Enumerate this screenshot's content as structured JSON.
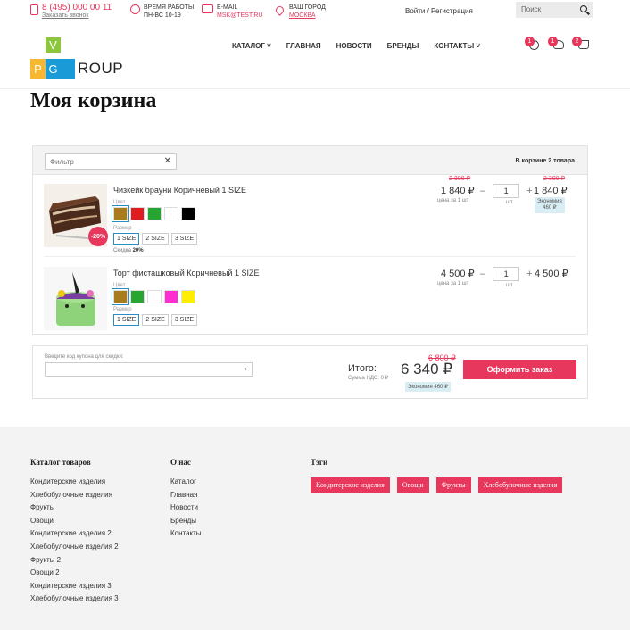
{
  "topbar": {
    "phone": "8 (495) 000 00 11",
    "callback": "Заказать звонок",
    "hours_title": "Время работы",
    "hours_value": "ПН-ВС 10-19",
    "email_title": "E-mail",
    "email_value": "msk@test.ru",
    "city_title": "Ваш город",
    "city_value": "Москва",
    "login": "Войти / Регистрация",
    "search_placeholder": "Поиск"
  },
  "header": {
    "logo_letters": [
      "V",
      "P",
      "G"
    ],
    "logo_text": "ROUP",
    "nav": [
      "Каталог ˅",
      "Главная",
      "Новости",
      "Бренды",
      "Контакты ˅"
    ],
    "badges": {
      "compare": "1",
      "favorites": "1",
      "cart": "2"
    }
  },
  "page_title": "Моя корзина",
  "basket": {
    "filter_placeholder": "Фильтр",
    "count_label": "В корзине 2 товара",
    "color_label": "Цвет",
    "size_label": "Размер",
    "unit": "шт",
    "items": [
      {
        "name": "Чизкейк брауни Коричневый 1 SIZE",
        "discount_badge": "-20%",
        "colors": [
          "#a87c1c",
          "#e11b22",
          "#27a532",
          "#ffffff",
          "#000000"
        ],
        "sizes": [
          "1 SIZE",
          "2 SIZE",
          "3 SIZE"
        ],
        "discount_label": "Скидка",
        "discount_value": "20%",
        "old_price": "2 300 ₽",
        "price": "1 840 ₽",
        "per_unit": "цена за 1 шт",
        "qty": "1",
        "total_old": "2 300 ₽",
        "total": "1 840 ₽",
        "economy_label": "Экономия",
        "economy_value": "460 ₽"
      },
      {
        "name": "Торт фисташковый Коричневый 1 SIZE",
        "colors": [
          "#a87c1c",
          "#27a532",
          "#ffffff",
          "#ff2ed1",
          "#ffee00"
        ],
        "sizes": [
          "1 SIZE",
          "2 SIZE",
          "3 SIZE"
        ],
        "price": "4 500 ₽",
        "per_unit": "цена за 1 шт",
        "qty": "1",
        "total": "4 500 ₽"
      }
    ]
  },
  "summary": {
    "coupon_label": "Введите код купона для скидки:",
    "total_label": "Итого:",
    "vat": "Сумма НДС: 0 ₽",
    "old_total": "6 800 ₽",
    "total": "6 340 ₽",
    "economy": "Экономия 460 ₽",
    "order_button": "Оформить заказ"
  },
  "footer": {
    "catalog_title": "Каталог товаров",
    "catalog_links": [
      "Кондитерские изделия",
      "Хлебобулочные изделия",
      "Фрукты",
      "Овощи",
      "Кондитерские изделия 2",
      "Хлебобулочные изделия 2",
      "Фрукты 2",
      "Овощи 2",
      "Кондитерские изделия 3",
      "Хлебобулочные изделия 3"
    ],
    "about_title": "О нас",
    "about_links": [
      "Каталог",
      "Главная",
      "Новости",
      "Бренды",
      "Контакты"
    ],
    "tags_title": "Тэги",
    "tags": [
      "Кондитерские изделия",
      "Овощи",
      "Фрукты",
      "Хлебобулочные изделия"
    ]
  },
  "colors": {
    "accent": "#e8375c",
    "logo_green": "#8cc63f",
    "logo_yellow": "#f7b733",
    "logo_blue": "#1a9bd7"
  }
}
